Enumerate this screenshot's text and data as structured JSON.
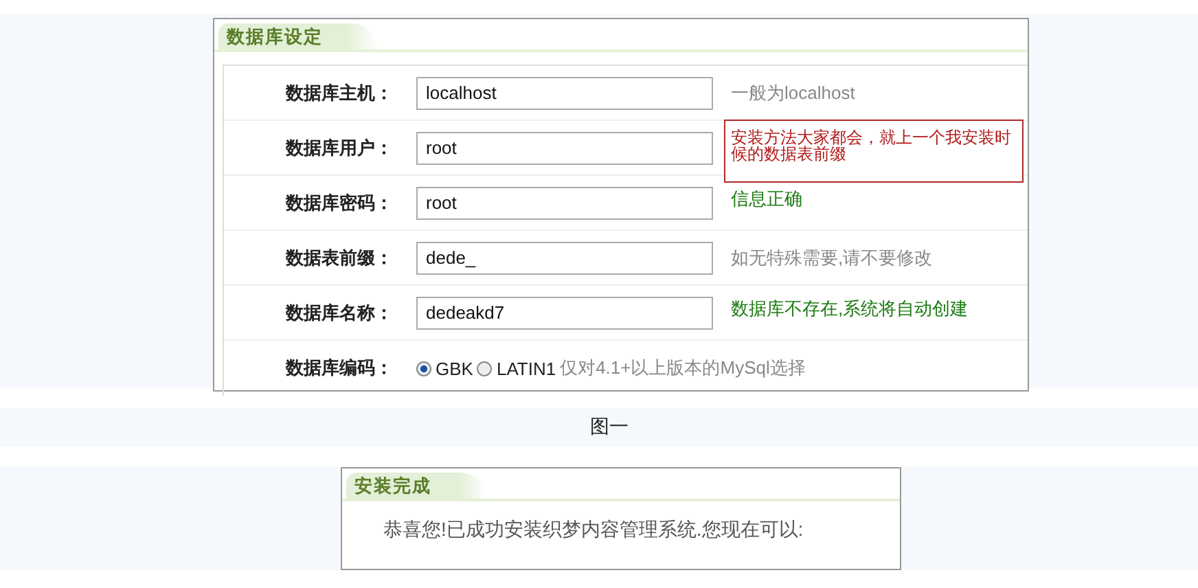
{
  "setup": {
    "title": "数据库设定",
    "rows": [
      {
        "label": "数据库主机：",
        "kind": "text",
        "value": "localhost",
        "hint": {
          "kind": "note",
          "text": "一般为localhost"
        }
      },
      {
        "label": "数据库用户：",
        "kind": "text",
        "value": "root",
        "hint": {
          "kind": "error",
          "text": "安装方法大家都会，就上一个我安装时候的数据表前缀"
        }
      },
      {
        "label": "数据库密码：",
        "kind": "text",
        "value": "root",
        "hint": {
          "kind": "ok",
          "text": "信息正确"
        }
      },
      {
        "label": "数据表前缀：",
        "kind": "text",
        "value": "dede_",
        "hint": {
          "kind": "note",
          "text": "如无特殊需要,请不要修改"
        }
      },
      {
        "label": "数据库名称：",
        "kind": "text",
        "value": "dedeakd7",
        "hint": {
          "kind": "ok",
          "text": "数据库不存在,系统将自动创建"
        }
      },
      {
        "label": "数据库编码：",
        "kind": "radio",
        "options": [
          {
            "label": "GBK",
            "selected": true
          },
          {
            "label": "LATIN1",
            "selected": false
          }
        ],
        "hint": {
          "kind": "note",
          "text": "仅对4.1+以上版本的MySql选择"
        }
      }
    ]
  },
  "caption": "图一",
  "done": {
    "title": "安装完成",
    "message": "恭喜您!已成功安装织梦内容管理系统.您现在可以:"
  }
}
